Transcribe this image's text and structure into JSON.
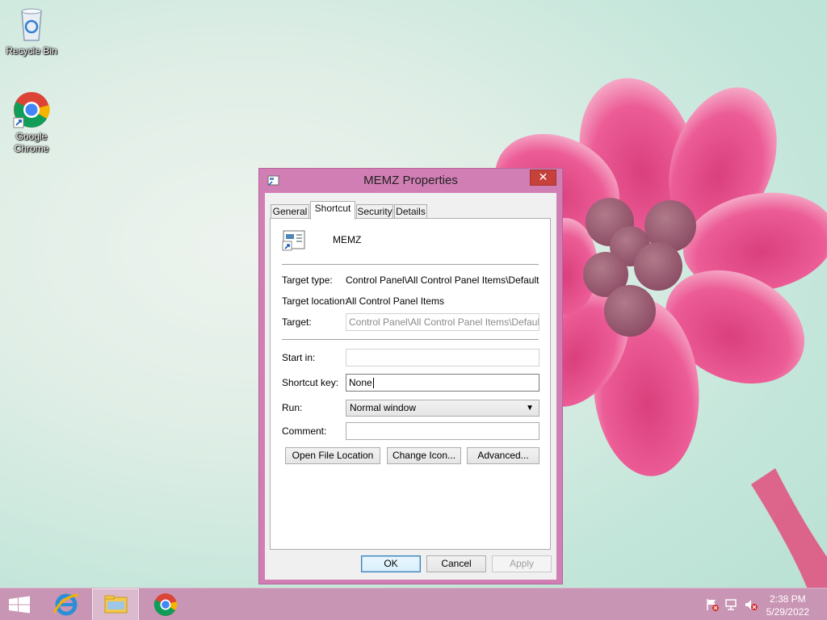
{
  "desktop": {
    "icons": [
      {
        "label": "Recycle Bin",
        "icon": "recycle-bin-icon"
      },
      {
        "label_line1": "Google",
        "label_line2": "Chrome",
        "icon": "chrome-icon"
      }
    ]
  },
  "dialog": {
    "title": "MEMZ Properties",
    "close_label": "✕",
    "tabs": [
      "General",
      "Shortcut",
      "Security",
      "Details"
    ],
    "active_tab": "Shortcut",
    "shortcut": {
      "name": "MEMZ",
      "target_type_label": "Target type:",
      "target_type_value": "Control Panel\\All Control Panel Items\\Default Progr",
      "target_location_label": "Target location:",
      "target_location_value": "All Control Panel Items",
      "target_label": "Target:",
      "target_value": "Control Panel\\All Control Panel Items\\Default Prog",
      "start_in_label": "Start in:",
      "start_in_value": "",
      "shortcut_key_label": "Shortcut key:",
      "shortcut_key_value": "None",
      "run_label": "Run:",
      "run_value": "Normal window",
      "comment_label": "Comment:",
      "comment_value": "",
      "open_file_location": "Open File Location",
      "change_icon": "Change Icon...",
      "advanced": "Advanced..."
    },
    "buttons": {
      "ok": "OK",
      "cancel": "Cancel",
      "apply": "Apply"
    }
  },
  "taskbar": {
    "items": [
      "start-icon",
      "internet-explorer-icon",
      "file-explorer-icon",
      "chrome-icon"
    ],
    "active_item": "file-explorer-icon",
    "tray": [
      "action-center-flag-icon",
      "network-icon",
      "volume-muted-icon"
    ],
    "time": "2:38 PM",
    "date": "5/29/2022"
  },
  "colors": {
    "window_frame": "#d17eb4",
    "taskbar": "#c995b4",
    "close_button": "#c7413b",
    "flower": "#e8578f"
  }
}
